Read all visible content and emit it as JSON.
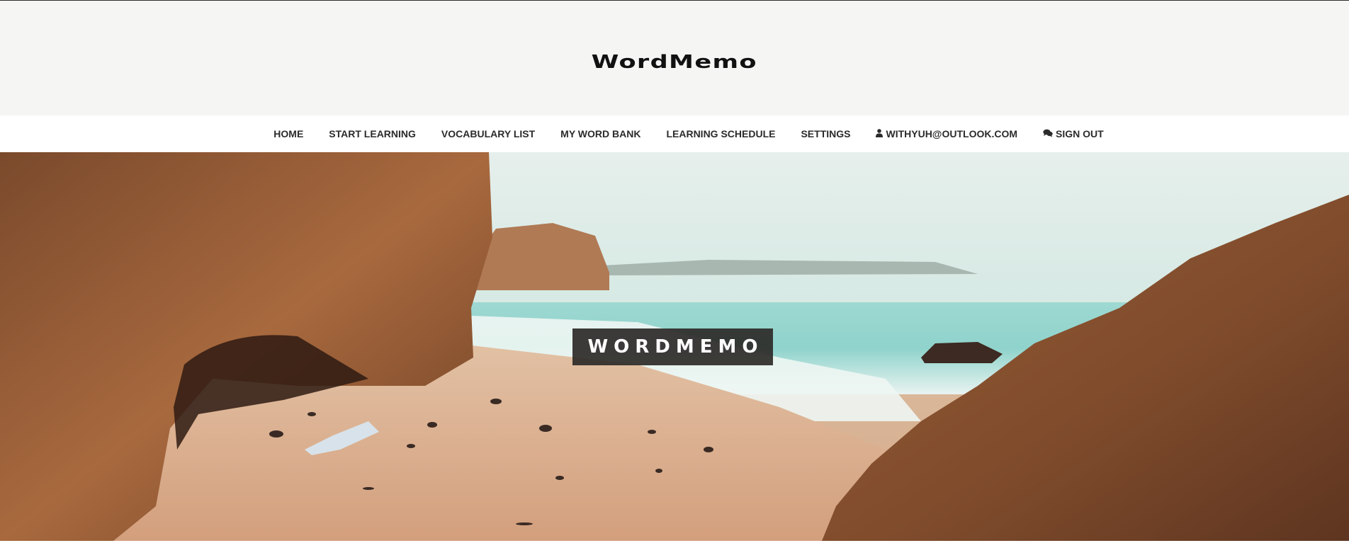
{
  "header": {
    "logo_text": "WordMemo"
  },
  "nav": {
    "items": [
      {
        "label": "HOME"
      },
      {
        "label": "START LEARNING"
      },
      {
        "label": "VOCABULARY LIST"
      },
      {
        "label": "MY WORD BANK"
      },
      {
        "label": "LEARNING SCHEDULE"
      },
      {
        "label": "SETTINGS"
      },
      {
        "label": "WITHYUH@OUTLOOK.COM",
        "icon": "user-icon"
      },
      {
        "label": "SIGN OUT",
        "icon": "comments-icon"
      }
    ]
  },
  "hero": {
    "title": "WORDMEMO"
  },
  "colors": {
    "header_bg": "#f5f5f3",
    "nav_text": "#2b2b2b",
    "badge_bg": "#2c2a28"
  }
}
